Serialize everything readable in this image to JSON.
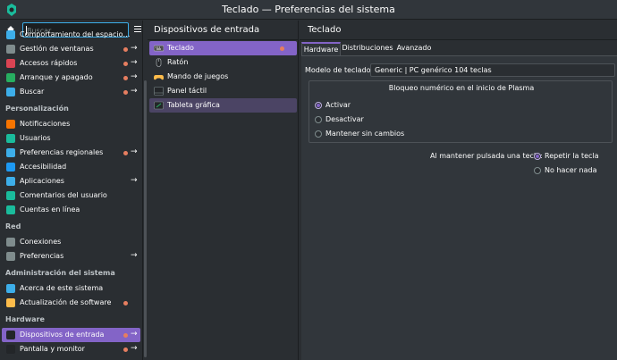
{
  "window": {
    "title": "Teclado — Preferencias del sistema"
  },
  "sidebar": {
    "search_placeholder": "Buscar...",
    "items_top": [
      {
        "label": "Comportamiento del espacio…",
        "dot": false,
        "arrow": false,
        "icon": "workspace-icon",
        "color": "#3daee9"
      },
      {
        "label": "Gestión de ventanas",
        "dot": true,
        "arrow": true,
        "icon": "window-management-icon",
        "color": "#7f8c8d"
      },
      {
        "label": "Accesos rápidos",
        "dot": true,
        "arrow": true,
        "icon": "shortcuts-icon",
        "color": "#da4453"
      },
      {
        "label": "Arranque y apagado",
        "dot": true,
        "arrow": true,
        "icon": "power-icon",
        "color": "#27ae60"
      },
      {
        "label": "Buscar",
        "dot": true,
        "arrow": true,
        "icon": "search-icon",
        "color": "#3daee9"
      }
    ],
    "cat_personalization": "Personalización",
    "items_personalization": [
      {
        "label": "Notificaciones",
        "dot": false,
        "arrow": false,
        "icon": "bell-icon",
        "color": "#f67400"
      },
      {
        "label": "Usuarios",
        "dot": false,
        "arrow": false,
        "icon": "users-icon",
        "color": "#1abc9c"
      },
      {
        "label": "Preferencias regionales",
        "dot": true,
        "arrow": true,
        "icon": "region-icon",
        "color": "#3daee9"
      },
      {
        "label": "Accesibilidad",
        "dot": false,
        "arrow": false,
        "icon": "accessibility-icon",
        "color": "#1d99f3"
      },
      {
        "label": "Aplicaciones",
        "dot": false,
        "arrow": true,
        "icon": "applications-icon",
        "color": "#3daee9"
      },
      {
        "label": "Comentarios del usuario",
        "dot": false,
        "arrow": false,
        "icon": "feedback-icon",
        "color": "#1abc9c"
      },
      {
        "label": "Cuentas en línea",
        "dot": false,
        "arrow": false,
        "icon": "online-accounts-icon",
        "color": "#1abc9c"
      }
    ],
    "cat_network": "Red",
    "items_network": [
      {
        "label": "Conexiones",
        "dot": false,
        "arrow": false,
        "icon": "connections-icon",
        "color": "#7f8c8d"
      },
      {
        "label": "Preferencias",
        "dot": false,
        "arrow": true,
        "icon": "network-settings-icon",
        "color": "#7f8c8d"
      }
    ],
    "cat_system": "Administración del sistema",
    "items_system": [
      {
        "label": "Acerca de este sistema",
        "dot": false,
        "arrow": false,
        "icon": "info-icon",
        "color": "#3daee9"
      },
      {
        "label": "Actualización de software",
        "dot": true,
        "arrow": false,
        "icon": "update-icon",
        "color": "#fdbc4b"
      }
    ],
    "cat_hardware": "Hardware",
    "items_hardware": [
      {
        "label": "Dispositivos de entrada",
        "dot": true,
        "arrow": true,
        "icon": "mouse-icon",
        "color": "#232629"
      },
      {
        "label": "Pantalla y monitor",
        "dot": true,
        "arrow": true,
        "icon": "display-icon",
        "color": "#232629"
      }
    ]
  },
  "middle": {
    "title": "Dispositivos de entrada",
    "items": [
      {
        "label": "Teclado",
        "dot": true
      },
      {
        "label": "Ratón",
        "dot": false
      },
      {
        "label": "Mando de juegos",
        "dot": false
      },
      {
        "label": "Panel táctil",
        "dot": false
      },
      {
        "label": "Tableta gráfica",
        "dot": false
      }
    ]
  },
  "content": {
    "title": "Teclado",
    "tabs": [
      "Hardware",
      "Distribuciones",
      "Avanzado"
    ],
    "model_label": "Modelo de teclado:",
    "model_value": "Generic | PC genérico 104 teclas",
    "numlock_title": "Bloqueo numérico en el inicio de Plasma",
    "numlock_options": [
      "Activar",
      "Desactivar",
      "Mantener sin cambios"
    ],
    "numlock_selected": 0,
    "repeat_label": "Al mantener pulsada una tecla:",
    "repeat_options": [
      "Repetir la tecla",
      "No hacer nada"
    ],
    "repeat_selected": 0
  },
  "colors": {
    "accent": "#8364c7",
    "attention_dot": "#e67e60",
    "background": "#2a2e32"
  }
}
